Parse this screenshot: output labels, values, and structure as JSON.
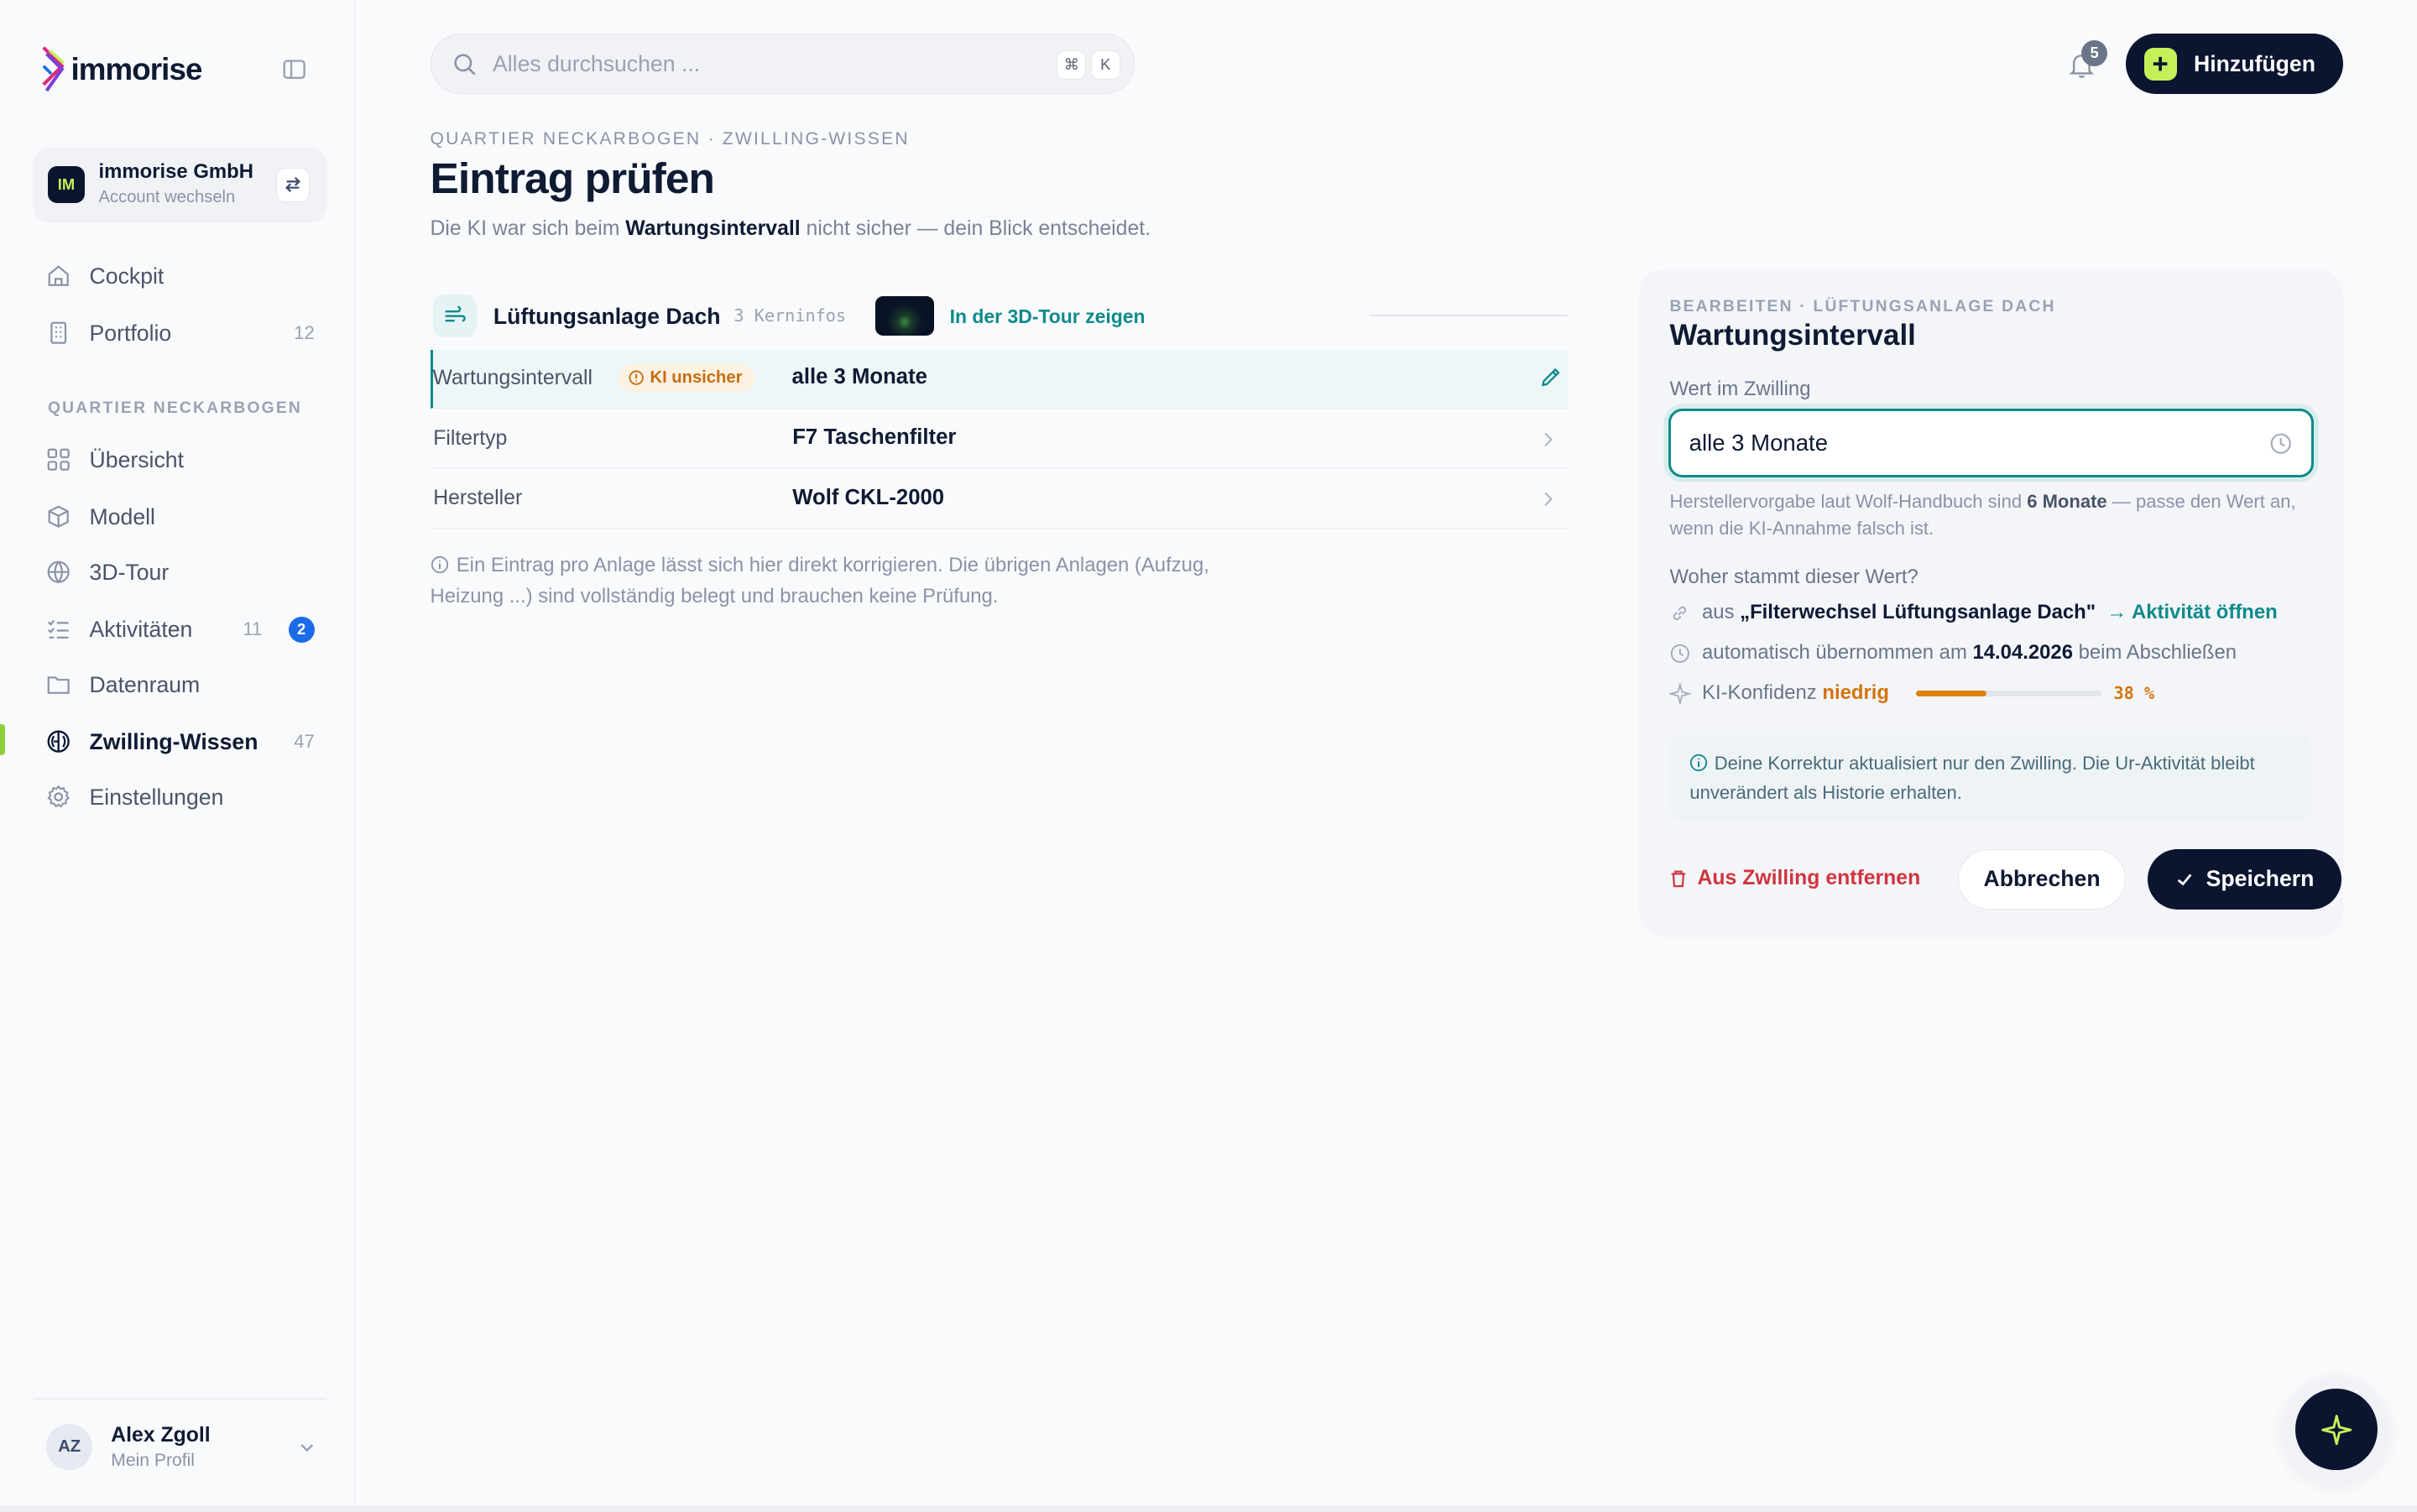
{
  "app": {
    "logo_text": "immorise",
    "accent": "#c4f05a",
    "brand_dark": "#0b1530",
    "teal": "#0e8a8a"
  },
  "account": {
    "initials": "IM",
    "name": "immorise GmbH",
    "sub": "Account wechseln"
  },
  "nav": {
    "main": [
      {
        "label": "Cockpit",
        "icon": "home-icon"
      },
      {
        "label": "Portfolio",
        "icon": "building-icon",
        "count": "12"
      }
    ],
    "section_label": "QUARTIER NECKARBOGEN",
    "quarter": [
      {
        "label": "Übersicht",
        "icon": "grid-icon"
      },
      {
        "label": "Modell",
        "icon": "cube-icon"
      },
      {
        "label": "3D-Tour",
        "icon": "globe-icon"
      },
      {
        "label": "Aktivitäten",
        "icon": "checklist-icon",
        "count": "11",
        "badge": "2"
      },
      {
        "label": "Datenraum",
        "icon": "folder-icon"
      },
      {
        "label": "Zwilling-Wissen",
        "icon": "brain-icon",
        "count": "47",
        "active": true
      },
      {
        "label": "Einstellungen",
        "icon": "gear-icon"
      }
    ]
  },
  "profile": {
    "initials": "AZ",
    "name": "Alex Zgoll",
    "sub": "Mein Profil"
  },
  "topbar": {
    "search_placeholder": "Alles durchsuchen ...",
    "kbd_cmd": "⌘",
    "kbd_k": "K",
    "notifications": "5",
    "add_label": "Hinzufügen"
  },
  "header": {
    "breadcrumb": "QUARTIER NECKARBOGEN · ZWILLING-WISSEN",
    "title": "Eintrag prüfen",
    "desc_pre": "Die KI war sich beim ",
    "desc_bold": "Wartungsintervall",
    "desc_post": " nicht sicher — dein Blick entscheidet."
  },
  "asset": {
    "name": "Lüftungsanlage Dach",
    "count": "3 Kerninfos",
    "tour_link": "In der 3D-Tour zeigen",
    "rows": [
      {
        "label": "Wartungsintervall",
        "badge": "KI unsicher",
        "value": "alle 3 Monate"
      },
      {
        "label": "Filtertyp",
        "value": "F7 Taschenfilter"
      },
      {
        "label": "Hersteller",
        "value": "Wolf CKL-2000"
      }
    ],
    "note": "Ein Eintrag pro Anlage lässt sich hier direkt korrigieren. Die übrigen Anlagen (Aufzug, Heizung ...) sind vollständig belegt und brauchen keine Prüfung."
  },
  "panel": {
    "crumb": "BEARBEITEN · LÜFTUNGSANLAGE DACH",
    "title": "Wartungsintervall",
    "field_label": "Wert im Zwilling",
    "field_value": "alle 3 Monate",
    "hint_pre": "Herstellervorgabe laut Wolf-Handbuch sind ",
    "hint_bold": "6 Monate",
    "hint_post": " — passe den Wert an, wenn die KI-Annahme falsch ist.",
    "origin_label": "Woher stammt dieser Wert?",
    "origin_from_pre": "aus ",
    "origin_from_bold": "„Filterwechsel Lüftungsanlage Dach\"",
    "origin_link": "→ Aktivität öffnen",
    "origin_date_pre": "automatisch übernommen am ",
    "origin_date": "14.04.2026",
    "origin_date_post": " beim Abschließen",
    "conf_label": "KI-Konfidenz ",
    "conf_level": "niedrig",
    "conf_value": 0.38,
    "conf_pct": "38 %",
    "note": "Deine Korrektur aktualisiert nur den Zwilling. Die Ur-Aktivität bleibt unverändert als Historie erhalten.",
    "remove_label": "Aus Zwilling entfernen",
    "cancel_label": "Abbrechen",
    "save_label": "Speichern"
  }
}
